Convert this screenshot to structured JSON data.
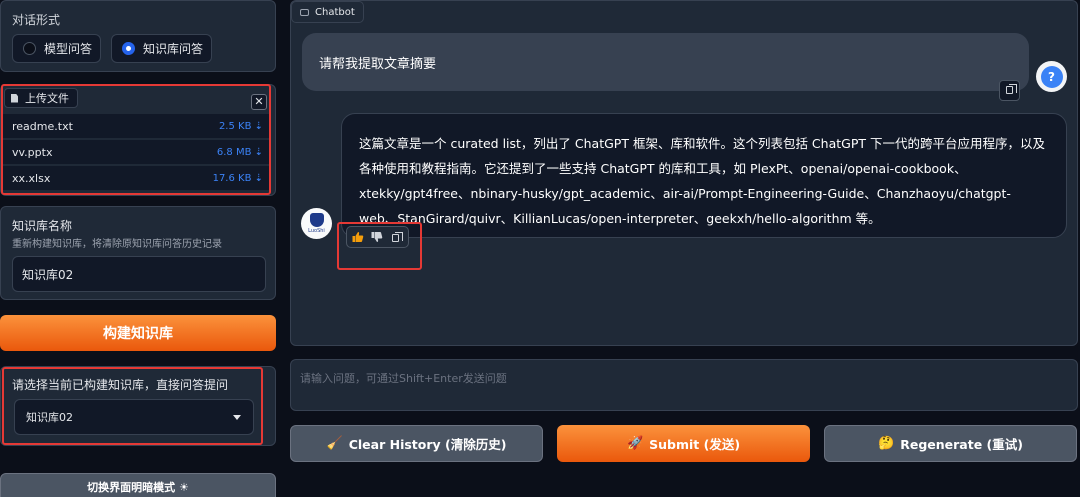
{
  "mode": {
    "title": "对话形式",
    "options": [
      "模型问答",
      "知识库问答"
    ],
    "selected": "知识库问答"
  },
  "upload": {
    "tag": "上传文件",
    "close": "✕",
    "files": [
      {
        "name": "readme.txt",
        "size": "2.5 KB ⇣"
      },
      {
        "name": "vv.pptx",
        "size": "6.8 MB ⇣"
      },
      {
        "name": "xx.xlsx",
        "size": "17.6 KB ⇣"
      }
    ]
  },
  "kb_name": {
    "label": "知识库名称",
    "hint": "重新构建知识库，将清除原知识库问答历史记录",
    "value": "知识库02"
  },
  "build_button": "构建知识库",
  "kb_select": {
    "label": "请选择当前已构建知识库，直接问答提问",
    "value": "知识库02"
  },
  "theme_button": "切换界面明暗模式 ☀",
  "chat": {
    "tag": "Chatbot",
    "user_message": "请帮我提取文章摘要",
    "user_avatar": "?",
    "bot_avatar_label": "LuoShi",
    "bot_message": "这篇文章是一个 curated list，列出了 ChatGPT 框架、库和软件。这个列表包括 ChatGPT 下一代的跨平台应用程序，以及各种使用和教程指南。它还提到了一些支持 ChatGPT 的库和工具，如 PlexPt、openai/openai-cookbook、xtekky/gpt4free、nbinary-husky/gpt_academic、air-ai/Prompt-Engineering-Guide、Chanzhaoyu/chatgpt-web、StanGirard/quivr、KillianLucas/open-interpreter、geekxh/hello-algorithm 等。"
  },
  "input": {
    "placeholder": "请输入问题，可通过Shift+Enter发送问题"
  },
  "buttons": {
    "clear": "Clear History (清除历史)",
    "clear_icon": "🧹",
    "submit": "Submit (发送)",
    "submit_icon": "🚀",
    "regenerate": "Regenerate (重试)",
    "regenerate_icon": "🤔"
  },
  "colors": {
    "accent": "#ea580c",
    "highlight": "#e53935",
    "link": "#3b82f6"
  }
}
